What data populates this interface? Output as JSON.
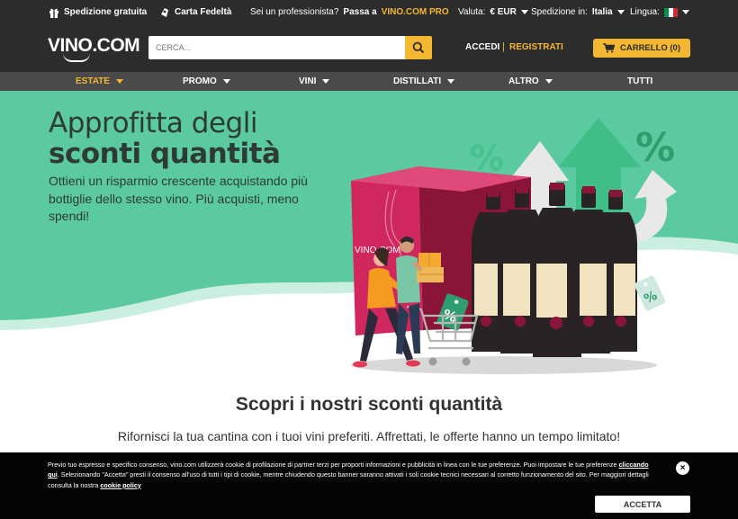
{
  "topbar": {
    "shipping": "Spedizione gratuita",
    "loyalty": "Carta Fedeltà",
    "pro_prompt": "Sei un professionista?",
    "pro_link_prefix": "Passa a",
    "pro_link_brand": "VINO.COM PRO",
    "currency_label": "Valuta:",
    "currency_value": "€ EUR",
    "ship_label": "Spedizione in:",
    "ship_value": "Italia",
    "lang_label": "Lingua:"
  },
  "header": {
    "logo": "VINO.COM",
    "search_placeholder": "CERCA...",
    "login": "ACCEDI",
    "separator": "|",
    "register": "REGISTRATI",
    "cart": "CARRELLO (0)"
  },
  "nav": {
    "items": [
      {
        "label": "ESTATE",
        "active": true
      },
      {
        "label": "PROMO"
      },
      {
        "label": "VINI"
      },
      {
        "label": "DISTILLATI"
      },
      {
        "label": "ALTRO"
      },
      {
        "label": "TUTTI"
      }
    ]
  },
  "hero": {
    "title_line1": "Approfitta degli",
    "title_line2": "sconti quantità",
    "subtitle": "Ottieni un risparmio crescente acquistando più bottiglie dello stesso vino. Più acquisti, meno spendi!",
    "box_brand": "VINO.COM",
    "percent_symbol": "%"
  },
  "section": {
    "title": "Scopri i nostri sconti quantità",
    "subtitle": "Rifornisci la tua cantina con i tuoi vini preferiti. Affrettati, le offerte hanno un tempo limitato!"
  },
  "cookie": {
    "text_1": "Previo tuo espresso e specifico consenso, vino.com utilizzerà cookie di profilazione di partner terzi per proporti informazioni e pubblicità in linea con le tue preferenze. Puoi impostare le tue preferenze ",
    "link_1": "cliccando qui",
    "text_2": ". Selezionando \"Accetta\" presti il consenso all'uso di tutti i tipi di cookie, mentre chiudendo questo banner saranno attivati i soli cookie tecnici necessari al corretto funzionamento del sito. Per maggiori dettagli consulta la nostra ",
    "link_2": "cookie policy",
    "close": "×",
    "accept": "ACCETTA"
  },
  "colors": {
    "dark": "#2c2c2c",
    "accent": "#f4b731",
    "mint": "#5ccaa0",
    "wine": "#8a1538"
  }
}
